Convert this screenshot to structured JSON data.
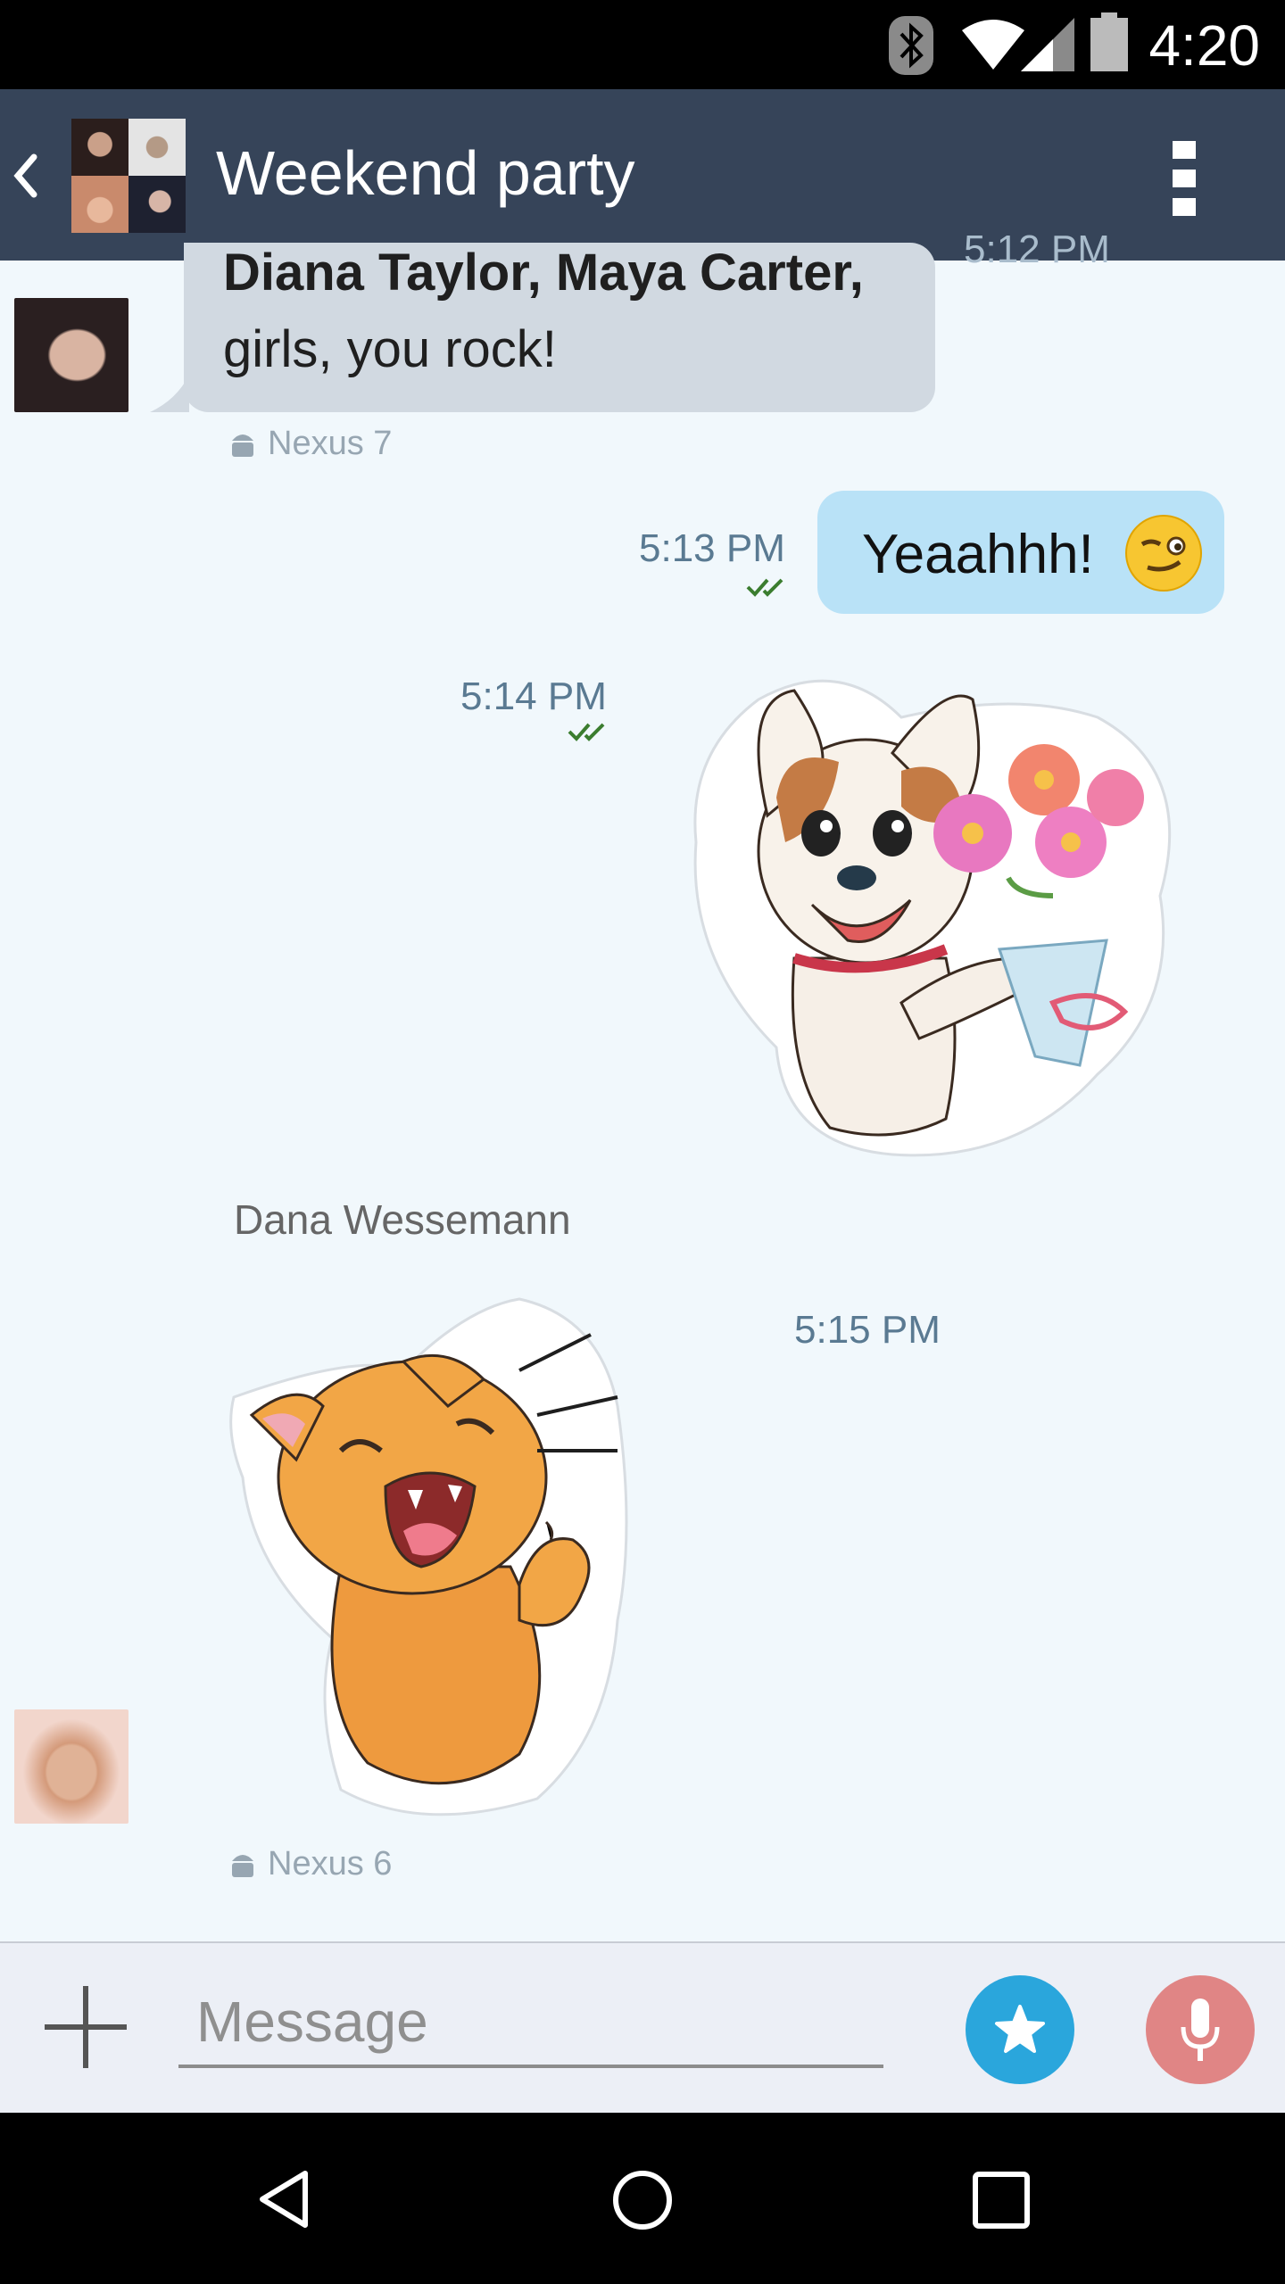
{
  "status_bar": {
    "time": "4:20",
    "icons": [
      "bluetooth-icon",
      "wifi-icon",
      "signal-icon",
      "battery-icon"
    ]
  },
  "header": {
    "title": "Weekend party",
    "back_icon": "chevron-left-icon",
    "menu_icon": "overflow-menu-icon"
  },
  "messages": {
    "m1": {
      "partial_time": "5:12 PM",
      "line1": "Diana Taylor, Maya Carter,",
      "line2": "girls, you rock!",
      "device": "Nexus 7"
    },
    "m2": {
      "text": "Yeaahhh!",
      "emoji": "winking-face-emoji",
      "time": "5:13 PM",
      "status": "read-double-check"
    },
    "m3": {
      "type": "sticker",
      "sticker": "dog-with-flowers-sticker",
      "time": "5:14 PM",
      "status": "read-double-check"
    },
    "m4": {
      "sender": "Dana Wessemann",
      "type": "sticker",
      "sticker": "laughing-cat-sticker",
      "time": "5:15 PM",
      "device": "Nexus 6"
    }
  },
  "composer": {
    "placeholder": "Message",
    "attach_icon": "plus-icon",
    "sticker_icon": "star-icon",
    "mic_icon": "microphone-icon"
  },
  "nav_bar": {
    "icons": [
      "back-triangle-icon",
      "home-circle-icon",
      "recents-square-icon"
    ]
  },
  "colors": {
    "header": "#364459",
    "background": "#f1f8fc",
    "outgoing_bubble": "#b9e2f7",
    "incoming_bubble": "#d1d9e1",
    "sticker_button": "#2aa6dc",
    "mic_button": "#e08585"
  }
}
